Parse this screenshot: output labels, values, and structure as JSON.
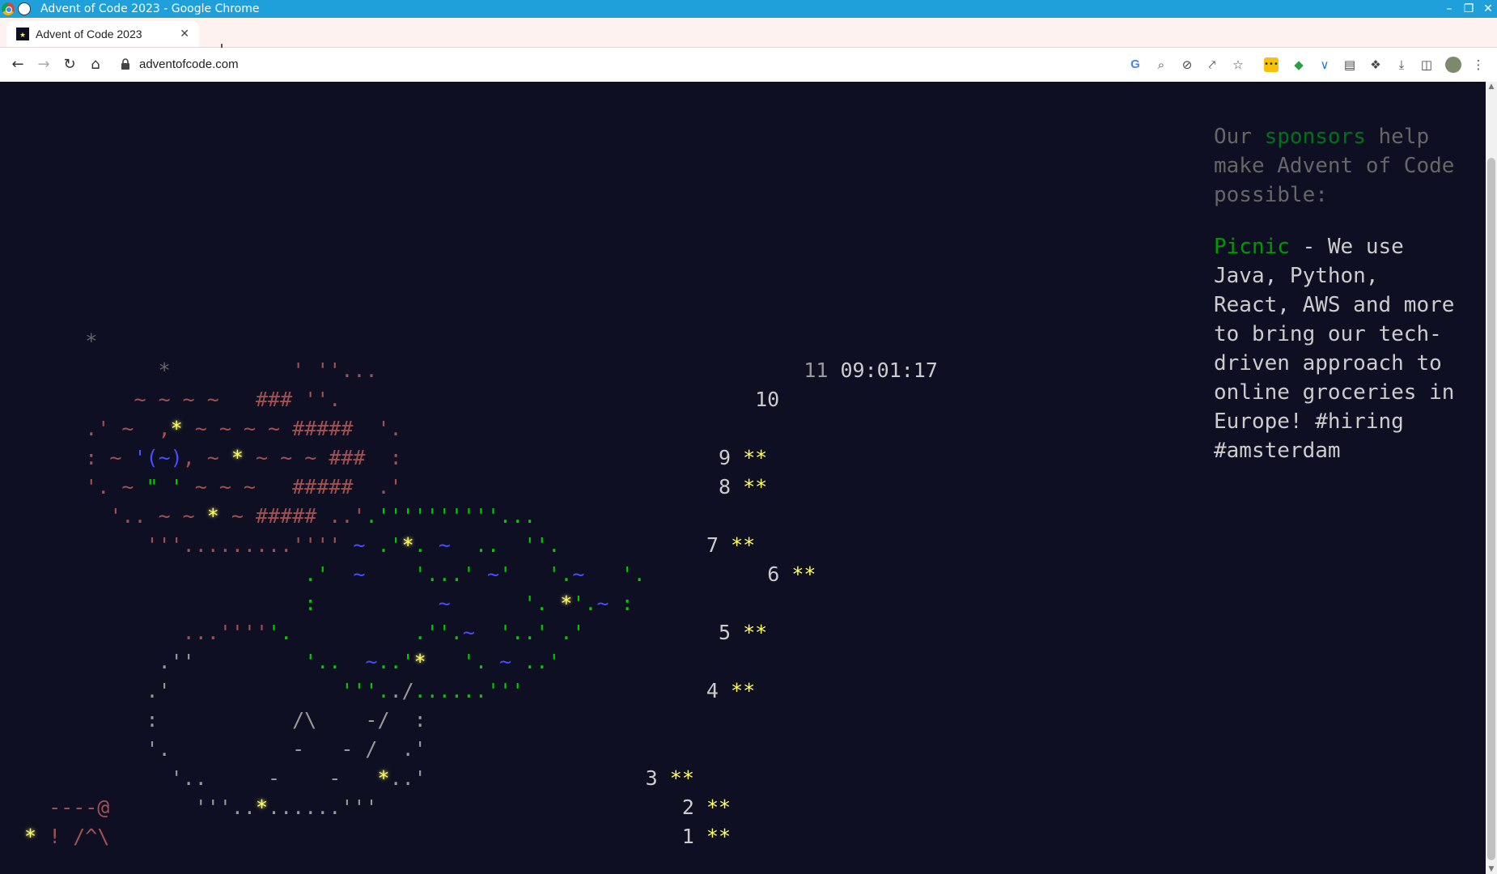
{
  "window": {
    "title": "Advent of Code 2023 - Google Chrome"
  },
  "tab": {
    "title": "Advent of Code 2023"
  },
  "address": {
    "url": "adventofcode.com"
  },
  "calendar": {
    "timer_day": "11",
    "countdown": "09:01:17",
    "days": [
      {
        "day": "10",
        "stars": ""
      },
      {
        "day": "9",
        "stars": "**"
      },
      {
        "day": "8",
        "stars": "**"
      },
      {
        "day": "7",
        "stars": "**"
      },
      {
        "day": "6",
        "stars": "**"
      },
      {
        "day": "5",
        "stars": "**"
      },
      {
        "day": "4",
        "stars": "**"
      },
      {
        "day": "3",
        "stars": "**"
      },
      {
        "day": "2",
        "stars": "**"
      },
      {
        "day": "1",
        "stars": "**"
      }
    ]
  },
  "sponsor": {
    "intro_before": "Our ",
    "intro_link": "sponsors",
    "intro_after": " help make Advent of Code possible:",
    "name": "Picnic",
    "text": " - We use Java, Python, React, AWS and more to bring our tech-driven approach to online groceries in Europe! #hiring #amsterdam"
  },
  "colors": {
    "background": "#0f0f23",
    "star": "#ffff66",
    "link": "#009900",
    "text": "#cccccc"
  }
}
